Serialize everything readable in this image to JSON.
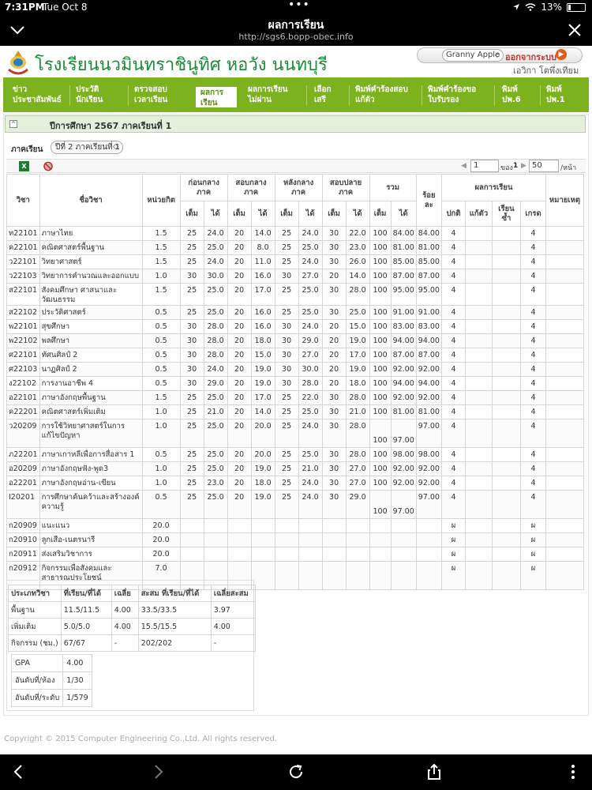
{
  "status": {
    "time": "7:31PM",
    "date": "Tue Oct 8",
    "battery": "13%"
  },
  "browser": {
    "title": "ผลการเรียน",
    "url": "http://sgs6.bopp-obec.info"
  },
  "header": {
    "school_name": "โรงเรียนนวมินทราชินูทิศ หอวัง นนทบุรี",
    "user_select": "Granny Apple",
    "logout_label": "ออกจากระบบ",
    "user_name": "เอวิกา โตพึ่งเทียม"
  },
  "menu": [
    {
      "label": "ข่าว\nประชาสัมพันธ์"
    },
    {
      "label": "ประวัติ\nนักเรียน"
    },
    {
      "label": "ตรวจสอบ\nเวลาเรียน"
    },
    {
      "label": "ผลการ\nเรียน"
    },
    {
      "label": "ผลการเรียน\nไม่ผ่าน"
    },
    {
      "label": "เลือก\nเสรี"
    },
    {
      "label": "พิมพ์คำร้องสอบ\nแก้ตัว"
    },
    {
      "label": "พิมพ์คำร้องขอ\nใบรับรอง"
    },
    {
      "label": "พิมพ์\nปพ.6"
    },
    {
      "label": "พิมพ์\nปพ.1"
    }
  ],
  "panel_title": "ปีการศึกษา 2567 ภาคเรียนที่ 1",
  "term": {
    "label": "ภาคเรียน",
    "selected": "ปีที่ 2 ภาคเรียนที่ 1"
  },
  "pager": {
    "page": "1",
    "of_label": "ของ",
    "total_pages": "1",
    "page_size": "50",
    "per_label": "/หน้า"
  },
  "columns": {
    "code": "วิชา",
    "name": "ชื่อวิชา",
    "credit": "หน่วยกิต",
    "midbefore": "ก่อนกลาง\nภาค",
    "mid": "สอบกลาง\nภาค",
    "midafter": "หลังกลาง\nภาค",
    "final": "สอบปลาย\nภาค",
    "total": "รวม",
    "percent": "ร้อย\nละ",
    "result": "ผลการเรียน",
    "note": "หมายเหตุ",
    "full": "เต็ม",
    "got": "ได้",
    "normal": "ปกติ",
    "retest": "แก้ตัว",
    "repeat": "เรียน\nซ้ำ",
    "grade": "เกรด"
  },
  "rows": [
    {
      "code": "ท22101",
      "name": "ภาษาไทย",
      "credit": "1.5",
      "f1": "25",
      "g1": "24.0",
      "f2": "20",
      "g2": "14.0",
      "f3": "25",
      "g3": "24.0",
      "f4": "30",
      "g4": "22.0",
      "tf": "100",
      "tg": "84.00",
      "pct": "84.00",
      "normal": "4",
      "retest": "",
      "repeat": "",
      "grade": "4"
    },
    {
      "code": "ค22101",
      "name": "คณิตศาสตร์พื้นฐาน",
      "credit": "1.5",
      "f1": "25",
      "g1": "25.0",
      "f2": "20",
      "g2": "8.0",
      "f3": "25",
      "g3": "25.0",
      "f4": "30",
      "g4": "23.0",
      "tf": "100",
      "tg": "81.00",
      "pct": "81.00",
      "normal": "4",
      "retest": "",
      "repeat": "",
      "grade": "4"
    },
    {
      "code": "ว22101",
      "name": "วิทยาศาสตร์",
      "credit": "1.5",
      "f1": "25",
      "g1": "24.0",
      "f2": "20",
      "g2": "11.0",
      "f3": "25",
      "g3": "24.0",
      "f4": "30",
      "g4": "26.0",
      "tf": "100",
      "tg": "85.00",
      "pct": "85.00",
      "normal": "4",
      "retest": "",
      "repeat": "",
      "grade": "4"
    },
    {
      "code": "ว22103",
      "name": "วิทยาการคำนวณและออกแบบ",
      "credit": "1.0",
      "f1": "30",
      "g1": "30.0",
      "f2": "20",
      "g2": "16.0",
      "f3": "30",
      "g3": "27.0",
      "f4": "20",
      "g4": "14.0",
      "tf": "100",
      "tg": "87.00",
      "pct": "87.00",
      "normal": "4",
      "retest": "",
      "repeat": "",
      "grade": "4"
    },
    {
      "code": "ส22101",
      "name": "สังคมศึกษา ศาสนาและวัฒนธรรม",
      "credit": "1.5",
      "f1": "25",
      "g1": "25.0",
      "f2": "20",
      "g2": "17.0",
      "f3": "25",
      "g3": "25.0",
      "f4": "30",
      "g4": "28.0",
      "tf": "100",
      "tg": "95.00",
      "pct": "95.00",
      "normal": "4",
      "retest": "",
      "repeat": "",
      "grade": "4"
    },
    {
      "code": "ส22102",
      "name": "ประวัติศาสตร์",
      "credit": "0.5",
      "f1": "25",
      "g1": "25.0",
      "f2": "20",
      "g2": "16.0",
      "f3": "25",
      "g3": "25.0",
      "f4": "30",
      "g4": "25.0",
      "tf": "100",
      "tg": "91.00",
      "pct": "91.00",
      "normal": "4",
      "retest": "",
      "repeat": "",
      "grade": "4"
    },
    {
      "code": "พ22101",
      "name": "สุขศึกษา",
      "credit": "0.5",
      "f1": "30",
      "g1": "28.0",
      "f2": "20",
      "g2": "16.0",
      "f3": "30",
      "g3": "24.0",
      "f4": "20",
      "g4": "15.0",
      "tf": "100",
      "tg": "83.00",
      "pct": "83.00",
      "normal": "4",
      "retest": "",
      "repeat": "",
      "grade": "4"
    },
    {
      "code": "พ22102",
      "name": "พลศึกษา",
      "credit": "0.5",
      "f1": "30",
      "g1": "28.0",
      "f2": "20",
      "g2": "18.0",
      "f3": "30",
      "g3": "29.0",
      "f4": "20",
      "g4": "19.0",
      "tf": "100",
      "tg": "94.00",
      "pct": "94.00",
      "normal": "4",
      "retest": "",
      "repeat": "",
      "grade": "4"
    },
    {
      "code": "ศ22101",
      "name": "ทัศนศิลป์ 2",
      "credit": "0.5",
      "f1": "30",
      "g1": "28.0",
      "f2": "20",
      "g2": "15.0",
      "f3": "30",
      "g3": "27.0",
      "f4": "20",
      "g4": "17.0",
      "tf": "100",
      "tg": "87.00",
      "pct": "87.00",
      "normal": "4",
      "retest": "",
      "repeat": "",
      "grade": "4"
    },
    {
      "code": "ศ22103",
      "name": "นาฏศิลป์ 2",
      "credit": "0.5",
      "f1": "30",
      "g1": "24.0",
      "f2": "20",
      "g2": "19.0",
      "f3": "30",
      "g3": "30.0",
      "f4": "20",
      "g4": "19.0",
      "tf": "100",
      "tg": "92.00",
      "pct": "92.00",
      "normal": "4",
      "retest": "",
      "repeat": "",
      "grade": "4"
    },
    {
      "code": "ง22102",
      "name": "การงานอาชีพ 4",
      "credit": "0.5",
      "f1": "30",
      "g1": "29.0",
      "f2": "20",
      "g2": "19.0",
      "f3": "30",
      "g3": "28.0",
      "f4": "20",
      "g4": "18.0",
      "tf": "100",
      "tg": "94.00",
      "pct": "94.00",
      "normal": "4",
      "retest": "",
      "repeat": "",
      "grade": "4"
    },
    {
      "code": "อ22101",
      "name": "ภาษาอังกฤษพื้นฐาน",
      "credit": "1.5",
      "f1": "25",
      "g1": "25.0",
      "f2": "20",
      "g2": "17.0",
      "f3": "25",
      "g3": "22.0",
      "f4": "30",
      "g4": "28.0",
      "tf": "100",
      "tg": "92.00",
      "pct": "92.00",
      "normal": "4",
      "retest": "",
      "repeat": "",
      "grade": "4"
    },
    {
      "code": "ค22201",
      "name": "คณิตศาสตร์เพิ่มเติม",
      "credit": "1.0",
      "f1": "25",
      "g1": "21.0",
      "f2": "20",
      "g2": "14.0",
      "f3": "25",
      "g3": "25.0",
      "f4": "30",
      "g4": "21.0",
      "tf": "100",
      "tg": "81.00",
      "pct": "81.00",
      "normal": "4",
      "retest": "",
      "repeat": "",
      "grade": "4"
    },
    {
      "code": "ว20209",
      "name": "การใช้วิทยาศาสตร์ในการแก้ไขปัญหา",
      "credit": "1.0",
      "f1": "25",
      "g1": "25.0",
      "f2": "20",
      "g2": "20.0",
      "f3": "25",
      "g3": "24.0",
      "f4": "30",
      "g4": "28.0",
      "tf": "100",
      "tg": "97.00",
      "pct": "97.00",
      "normal": "4",
      "retest": "",
      "repeat": "",
      "grade": "4",
      "tall": true
    },
    {
      "code": "ภ22201",
      "name": "ภาษาเกาหลีเพื่อการสื่อสาร 1",
      "credit": "0.5",
      "f1": "25",
      "g1": "25.0",
      "f2": "20",
      "g2": "20.0",
      "f3": "25",
      "g3": "25.0",
      "f4": "30",
      "g4": "28.0",
      "tf": "100",
      "tg": "98.00",
      "pct": "98.00",
      "normal": "4",
      "retest": "",
      "repeat": "",
      "grade": "4"
    },
    {
      "code": "อ20209",
      "name": "ภาษาอังกฤษฟัง-พูด3",
      "credit": "1.0",
      "f1": "25",
      "g1": "25.0",
      "f2": "20",
      "g2": "19.0",
      "f3": "25",
      "g3": "21.0",
      "f4": "30",
      "g4": "27.0",
      "tf": "100",
      "tg": "92.00",
      "pct": "92.00",
      "normal": "4",
      "retest": "",
      "repeat": "",
      "grade": "4"
    },
    {
      "code": "อ22201",
      "name": "ภาษาอังกฤษอ่าน-เขียน",
      "credit": "1.0",
      "f1": "25",
      "g1": "23.0",
      "f2": "20",
      "g2": "18.0",
      "f3": "25",
      "g3": "24.0",
      "f4": "30",
      "g4": "27.0",
      "tf": "100",
      "tg": "92.00",
      "pct": "92.00",
      "normal": "4",
      "retest": "",
      "repeat": "",
      "grade": "4"
    },
    {
      "code": "I20201",
      "name": "การศึกษาค้นคว้าและสร้างองค์ความรู้",
      "credit": "0.5",
      "f1": "25",
      "g1": "25.0",
      "f2": "20",
      "g2": "19.0",
      "f3": "25",
      "g3": "24.0",
      "f4": "30",
      "g4": "29.0",
      "tf": "100",
      "tg": "97.00",
      "pct": "97.00",
      "normal": "4",
      "retest": "",
      "repeat": "",
      "grade": "4",
      "tall": true
    },
    {
      "code": "ก20909",
      "name": "แนะแนว",
      "credit": "20.0",
      "f1": "",
      "g1": "",
      "f2": "",
      "g2": "",
      "f3": "",
      "g3": "",
      "f4": "",
      "g4": "",
      "tf": "",
      "tg": "",
      "pct": "",
      "normal": "ผ",
      "retest": "",
      "repeat": "",
      "grade": "ผ"
    },
    {
      "code": "ก20910",
      "name": "ลูกเสือ-เนตรนารี",
      "credit": "20.0",
      "f1": "",
      "g1": "",
      "f2": "",
      "g2": "",
      "f3": "",
      "g3": "",
      "f4": "",
      "g4": "",
      "tf": "",
      "tg": "",
      "pct": "",
      "normal": "ผ",
      "retest": "",
      "repeat": "",
      "grade": "ผ"
    },
    {
      "code": "ก20911",
      "name": "ส่งเสริมวิชาการ",
      "credit": "20.0",
      "f1": "",
      "g1": "",
      "f2": "",
      "g2": "",
      "f3": "",
      "g3": "",
      "f4": "",
      "g4": "",
      "tf": "",
      "tg": "",
      "pct": "",
      "normal": "ผ",
      "retest": "",
      "repeat": "",
      "grade": "ผ"
    },
    {
      "code": "ก20912",
      "name": "กิจกรรมเพื่อสังคมและสาธารณประโยชน์",
      "credit": "7.0",
      "f1": "",
      "g1": "",
      "f2": "",
      "g2": "",
      "f3": "",
      "g3": "",
      "f4": "",
      "g4": "",
      "tf": "",
      "tg": "",
      "pct": "",
      "normal": "ผ",
      "retest": "",
      "repeat": "",
      "grade": "ผ",
      "tall": true
    }
  ],
  "summary": {
    "headers": [
      "ประเภทวิชา",
      "ที่เรียน/ที่ได้",
      "เฉลี่ย",
      "สะสม ที่เรียน/ที่ได้",
      "เฉลี่ยสะสม"
    ],
    "rows": [
      [
        "พื้นฐาน",
        "11.5/11.5",
        "4.00",
        "33.5/33.5",
        "3.97"
      ],
      [
        "เพิ่มเติม",
        "5.0/5.0",
        "4.00",
        "15.5/15.5",
        "4.00"
      ],
      [
        "กิจกรรม (ชม.)",
        "67/67",
        "-",
        "202/202",
        "-"
      ]
    ],
    "gpa_label": "GPA",
    "gpa": "4.00",
    "rank_class_label": "อันดับที่/ห้อง",
    "rank_class": "1/30",
    "rank_level_label": "อันดับที่/ระดับ",
    "rank_level": "1/579"
  },
  "copyright": "Copyright © 2015 Computer Engineering Co.,Ltd. All rights reserved.",
  "colors": {
    "menu_green": "#7cb21e",
    "school_green": "#1b8a3a",
    "logout_red": "#c0392b"
  }
}
